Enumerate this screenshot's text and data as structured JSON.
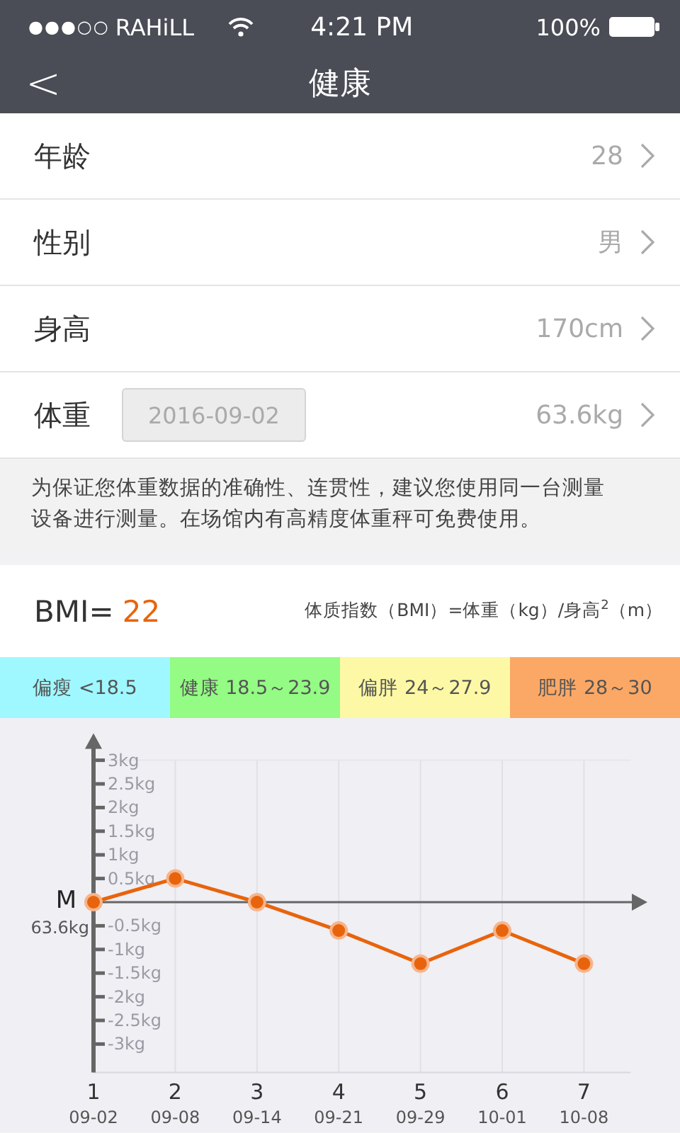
{
  "status_bar": {
    "signal": "●●●○○",
    "carrier": "RAHiLL",
    "time": "4:21 PM",
    "battery": "100%"
  },
  "nav": {
    "back": "<",
    "title": "健康"
  },
  "rows": [
    {
      "label": "年龄",
      "value": "28"
    },
    {
      "label": "性别",
      "value": "男"
    },
    {
      "label": "身高",
      "value": "170cm"
    },
    {
      "label": "体重",
      "date": "2016-09-02",
      "value": "63.6kg"
    }
  ],
  "notice": "为保证您体重数据的准确性、连贯性，建议您使用同一台测量设备进行测量。在场馆内有高精度体重秤可免费使用。",
  "bmi": {
    "label": "BMI=",
    "value": "22",
    "formula": "体质指数（BMI）=体重（kg）/身高$^{2}$（m）"
  },
  "legend": [
    {
      "label": "偏瘦 <18.5",
      "color": "#9ff8ff"
    },
    {
      "label": "健康 18.5～23.9",
      "color": "#94fb84"
    },
    {
      "label": "偏胖 24～27.9",
      "color": "#fdf8a5"
    },
    {
      "label": "肥胖 28～30",
      "color": "#fba866"
    }
  ],
  "chart": {
    "baseline_label": "M",
    "baseline_value": "63.6kg",
    "dates": [
      "09-02",
      "09-08",
      "09-14",
      "09-21",
      "09-29",
      "10-01",
      "10-08"
    ],
    "chart_data": {
      "type": "line",
      "categories": [
        "1",
        "2",
        "3",
        "4",
        "5",
        "6",
        "7"
      ],
      "series": [
        {
          "color": "#e8640c",
          "marker": "o",
          "values": [
            0,
            0.5,
            0,
            -0.6,
            -1.3,
            -0.6,
            -1.3
          ]
        }
      ],
      "grid": true,
      "ylim": [
        -3.6,
        3
      ],
      "yticks": [
        {
          "value": 3,
          "label": "3kg"
        },
        {
          "value": 2.5,
          "label": "2.5kg"
        },
        {
          "value": 2,
          "label": "2kg"
        },
        {
          "value": 1.5,
          "label": "1.5kg"
        },
        {
          "value": 1,
          "label": "1kg"
        },
        {
          "value": 0.5,
          "label": "0.5kg"
        },
        {
          "value": -0.5,
          "label": "-0.5kg"
        },
        {
          "value": -1,
          "label": "-1kg"
        },
        {
          "value": -1.5,
          "label": "-1.5kg"
        },
        {
          "value": -2,
          "label": "-2kg"
        },
        {
          "value": -2.5,
          "label": "-2.5kg"
        },
        {
          "value": -3,
          "label": "-3kg"
        }
      ]
    }
  }
}
